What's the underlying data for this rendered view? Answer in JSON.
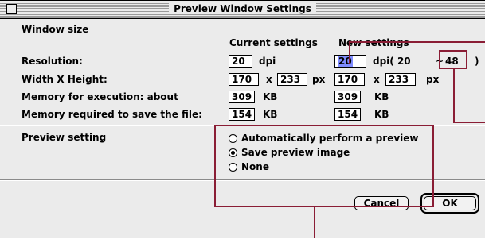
{
  "window": {
    "title": "Preview Window Settings"
  },
  "section": {
    "window_size": "Window size",
    "preview_setting": "Preview setting"
  },
  "headers": {
    "current": "Current settings",
    "new": "New settings"
  },
  "rows": {
    "resolution": {
      "label": "Resolution:",
      "current_value": "20",
      "current_unit": "dpi",
      "new_value": "20",
      "new_unit_prefix": "dpi( 20",
      "tilde": "~",
      "max_value": "48",
      "close_paren": ")"
    },
    "width_height": {
      "label": "Width X Height:",
      "current_w": "170",
      "current_x": "x",
      "current_h": "233",
      "current_unit": "px",
      "new_w": "170",
      "new_x": "x",
      "new_h": "233",
      "new_unit": "px"
    },
    "memory_exec": {
      "label": "Memory for execution: about",
      "current_value": "309",
      "current_unit": "KB",
      "new_value": "309",
      "new_unit": "KB"
    },
    "memory_save": {
      "label": "Memory required to save the file:",
      "current_value": "154",
      "current_unit": "KB",
      "new_value": "154",
      "new_unit": "KB"
    }
  },
  "preview_options": [
    {
      "label": "Automatically perform a preview",
      "selected": false
    },
    {
      "label": "Save preview image",
      "selected": true
    },
    {
      "label": "None",
      "selected": false
    }
  ],
  "buttons": {
    "cancel": "Cancel",
    "ok": "OK"
  },
  "colors": {
    "callout": "#8a1d35",
    "selection": "#7f8cff",
    "window_bg": "#ebebeb"
  }
}
